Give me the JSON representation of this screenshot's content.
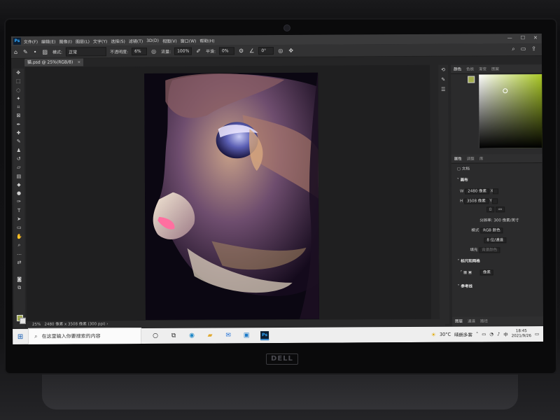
{
  "menu": {
    "items": [
      "文件(F)",
      "编辑(E)",
      "图像(I)",
      "图层(L)",
      "文字(Y)",
      "选择(S)",
      "滤镜(T)",
      "3D(D)",
      "视图(V)",
      "窗口(W)",
      "帮助(H)"
    ]
  },
  "options": {
    "mode_label": "模式:",
    "mode_value": "正常",
    "opacity_label": "不透明度:",
    "opacity_value": "6%",
    "flow_label": "流量:",
    "flow_value": "100%",
    "smooth_label": "平滑:",
    "smooth_value": "0%",
    "angle_value": "0°"
  },
  "document": {
    "tab_title": "猫.psd @ 25%(RGB/8)",
    "zoom": "25%",
    "info": "2480 像素 x 3508 像素 (300 ppi)"
  },
  "color_panel": {
    "tabs": [
      "颜色",
      "色板",
      "渐变",
      "图案"
    ],
    "foreground": "#a3ad4e"
  },
  "properties": {
    "tabs": [
      "属性",
      "调整",
      "库"
    ],
    "doc_label": "文档",
    "canvas_section": "画布",
    "w_label": "W",
    "w_value": "2480 像素",
    "h_label": "H",
    "h_value": "3508 像素",
    "x_label": "X",
    "y_label": "Y",
    "resolution": "分辨率: 300 像素/英寸",
    "mode_label": "模式",
    "mode_value": "RGB 颜色",
    "bits_value": "8 位/通道",
    "fill_label": "填充",
    "fill_value": "背景颜色",
    "rulers_section": "标尺和网格",
    "units_value": "像素",
    "guides_section": "参考线"
  },
  "bottom_tabs": [
    "图层",
    "通道",
    "路径"
  ],
  "taskbar": {
    "search_placeholder": "在这里输入你要搜索的内容",
    "temperature": "30°C",
    "weather": "晴朗多雾",
    "ime": "中",
    "time": "18:45",
    "date": "2021/9/26"
  }
}
